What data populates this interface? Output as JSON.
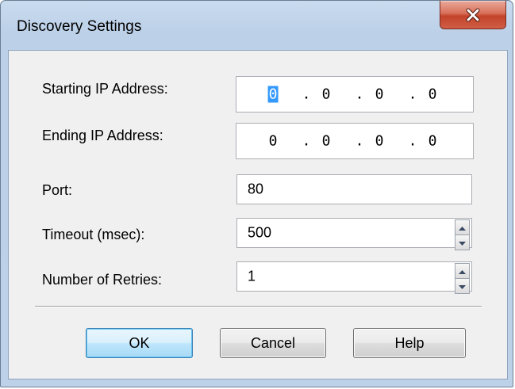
{
  "window": {
    "title": "Discovery Settings"
  },
  "form": {
    "start_ip": {
      "label": "Starting IP Address:",
      "octets": [
        "0",
        "0",
        "0",
        "0"
      ]
    },
    "end_ip": {
      "label": "Ending IP Address:",
      "octets": [
        "0",
        "0",
        "0",
        "0"
      ]
    },
    "port": {
      "label": "Port:",
      "value": "80"
    },
    "timeout": {
      "label": "Timeout (msec):",
      "value": "500"
    },
    "retries": {
      "label": "Number of Retries:",
      "value": "1"
    }
  },
  "buttons": {
    "ok": "OK",
    "cancel": "Cancel",
    "help": "Help"
  },
  "icons": {
    "close": "close-icon",
    "spin_up": "arrow-up-icon",
    "spin_down": "arrow-down-icon"
  },
  "colors": {
    "selection": "#3399ff",
    "close_button": "#c3432a",
    "default_button_border": "#3c7fb1"
  }
}
